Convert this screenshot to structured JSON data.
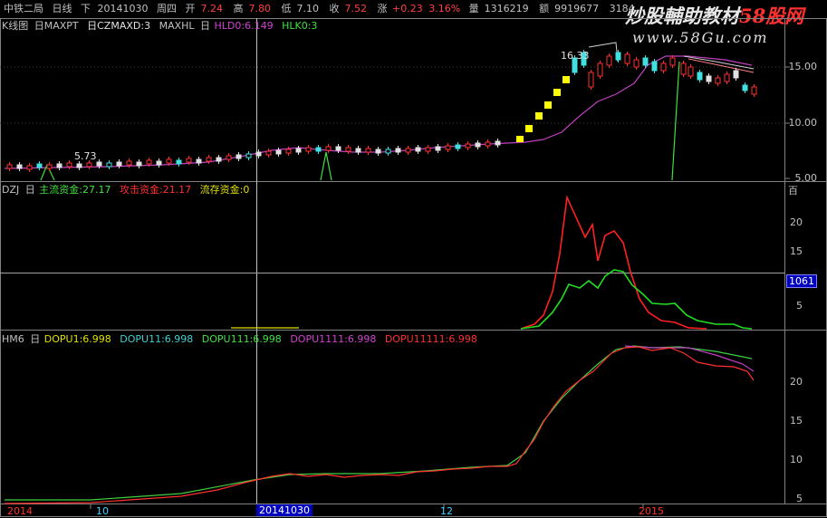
{
  "topbar": {
    "stock": "中铁二局",
    "period": "日线",
    "adj": "下",
    "date": "20141030",
    "weekday": "周四",
    "open_label": "开",
    "open": "7.24",
    "high_label": "高",
    "high": "7.80",
    "low_label": "低",
    "low": "7.10",
    "close_label": "收",
    "close": "7.52",
    "change_label": "涨",
    "change": "+0.23",
    "change_pct": "3.16%",
    "volume_label": "量",
    "volume": "1316219",
    "amount_label": "额",
    "amount": "9919677",
    "extra": "3184"
  },
  "watermark": {
    "line1": "炒股輔助教材",
    "line1_suffix": "58股网",
    "line2": "www.58Gu.com"
  },
  "panel1": {
    "title": "K线图",
    "items": [
      {
        "label": "日MAXPT",
        "color": "#c0c0c0"
      },
      {
        "label": "日CZMAXD:3",
        "color": "#e0e0e0"
      },
      {
        "label": "MAXHL",
        "color": "#c0c0c0"
      },
      {
        "label": "日",
        "color": "#c0c0c0"
      },
      {
        "label": "HLD0:6.149",
        "color": "#d040d0"
      },
      {
        "label": "HLK0:3",
        "color": "#40e040"
      }
    ],
    "yticks": [
      "15.00",
      "10.00",
      "5.00"
    ],
    "annotations": [
      {
        "text": "5.73"
      },
      {
        "text": "16.33"
      }
    ]
  },
  "panel2": {
    "title": "DZJ",
    "items": [
      {
        "label": "日",
        "color": "#c0c0c0"
      },
      {
        "label": "主流资金:27.17",
        "color": "#40e040"
      },
      {
        "label": "攻击资金:21.17",
        "color": "#ff3030"
      },
      {
        "label": "流存资金:0",
        "color": "#e0e000"
      }
    ],
    "unit": "百",
    "yticks": [
      "20",
      "15",
      "5"
    ],
    "cursor_value": "1061"
  },
  "panel3": {
    "title": "HM6",
    "items": [
      {
        "label": "日",
        "color": "#c0c0c0"
      },
      {
        "label": "DOPU1:6.998",
        "color": "#e0e000"
      },
      {
        "label": "DOPU11:6.998",
        "color": "#40d0d0"
      },
      {
        "label": "DOPU111:6.998",
        "color": "#40e040"
      },
      {
        "label": "DOPU1111:6.998",
        "color": "#d040d0"
      },
      {
        "label": "DOPU11111:6.998",
        "color": "#ff3030"
      }
    ],
    "yticks": [
      "20",
      "15",
      "10",
      "5"
    ]
  },
  "xaxis": {
    "labels": [
      "2014",
      "10",
      "20141030",
      "12",
      "2015"
    ]
  }
}
